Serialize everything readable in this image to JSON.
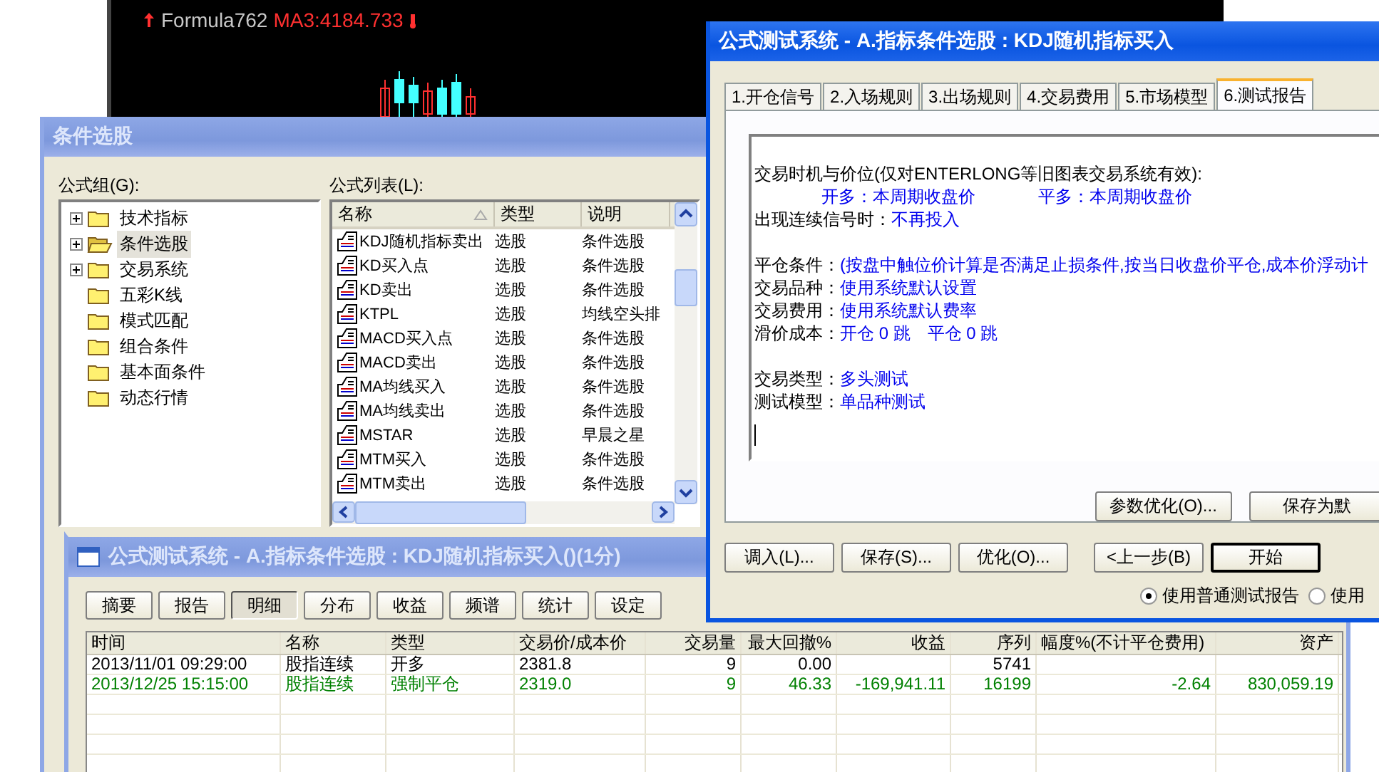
{
  "chart": {
    "indicator": "Formula762",
    "ma": "MA3:4184.733"
  },
  "stock_select": {
    "title": "条件选股",
    "group_label": "公式组(G):",
    "list_label": "公式列表(L):",
    "groups": [
      {
        "label": "技术指标",
        "expandable": true,
        "selected": false
      },
      {
        "label": "条件选股",
        "expandable": true,
        "selected": true
      },
      {
        "label": "交易系统",
        "expandable": true,
        "selected": false
      },
      {
        "label": "五彩K线",
        "expandable": false,
        "selected": false
      },
      {
        "label": "模式匹配",
        "expandable": false,
        "selected": false
      },
      {
        "label": "组合条件",
        "expandable": false,
        "selected": false
      },
      {
        "label": "基本面条件",
        "expandable": false,
        "selected": false
      },
      {
        "label": "动态行情",
        "expandable": false,
        "selected": false
      }
    ],
    "columns": [
      "名称",
      "类型",
      "说明"
    ],
    "rows": [
      {
        "name": "KDJ随机指标卖出",
        "type": "选股",
        "desc": "条件选股"
      },
      {
        "name": "KD买入点",
        "type": "选股",
        "desc": "条件选股"
      },
      {
        "name": "KD卖出",
        "type": "选股",
        "desc": "条件选股"
      },
      {
        "name": "KTPL",
        "type": "选股",
        "desc": "均线空头排"
      },
      {
        "name": "MACD买入点",
        "type": "选股",
        "desc": "条件选股"
      },
      {
        "name": "MACD卖出",
        "type": "选股",
        "desc": "条件选股"
      },
      {
        "name": "MA均线买入",
        "type": "选股",
        "desc": "条件选股"
      },
      {
        "name": "MA均线卖出",
        "type": "选股",
        "desc": "条件选股"
      },
      {
        "name": "MSTAR",
        "type": "选股",
        "desc": "早晨之星"
      },
      {
        "name": "MTM买入",
        "type": "选股",
        "desc": "条件选股"
      },
      {
        "name": "MTM卖出",
        "type": "选股",
        "desc": "条件选股"
      }
    ]
  },
  "tester": {
    "title": "公式测试系统 - A.指标条件选股 : KDJ随机指标买入",
    "tabs": [
      {
        "label": "1.开仓信号",
        "selected": false
      },
      {
        "label": "2.入场规则",
        "selected": false
      },
      {
        "label": "3.出场规则",
        "selected": false
      },
      {
        "label": "4.交易费用",
        "selected": false
      },
      {
        "label": "5.市场模型",
        "selected": false
      },
      {
        "label": "6.测试报告",
        "selected": true
      }
    ],
    "report": [
      [
        {
          "label": "交易时机与价位(仅对ENTERLONG等旧图表交易系统有效):"
        },
        {
          "values": [
            "开多：本周期收盘价",
            "平多：本周期收盘价"
          ]
        },
        {
          "label": "出现连续信号时：",
          "values": [
            "不再投入"
          ]
        }
      ],
      [
        {
          "label": "平仓条件：",
          "values": [
            "(按盘中触位价计算是否满足止损条件,按当日收盘价平仓,成本价浮动计"
          ]
        },
        {
          "label": "交易品种：",
          "values": [
            "使用系统默认设置"
          ]
        },
        {
          "label": "交易费用：",
          "values": [
            "使用系统默认费率"
          ]
        },
        {
          "label": "滑价成本：",
          "values": [
            "开仓 0 跳　平仓 0 跳"
          ]
        }
      ],
      [
        {
          "label": "交易类型：",
          "values": [
            "多头测试"
          ]
        },
        {
          "label": "测试模型：",
          "values": [
            "单品种测试"
          ]
        }
      ]
    ],
    "panel_buttons": [
      "参数优化(O)...",
      "保存为默"
    ],
    "buttons": [
      {
        "label": "调入(L)...",
        "default": false
      },
      {
        "label": "保存(S)...",
        "default": false
      },
      {
        "label": "优化(O)...",
        "default": false
      },
      {
        "label": "<上一步(B)",
        "default": false
      },
      {
        "label": "开始",
        "default": true
      }
    ],
    "report_modes": [
      {
        "label": "使用普通测试报告",
        "selected": true
      },
      {
        "label": "使用",
        "selected": false
      }
    ]
  },
  "results": {
    "title": "公式测试系统 - A.指标条件选股 : KDJ随机指标买入()(1分)",
    "views": [
      {
        "label": "摘要",
        "selected": false
      },
      {
        "label": "报告",
        "selected": false
      },
      {
        "label": "明细",
        "selected": true
      },
      {
        "label": "分布",
        "selected": false
      },
      {
        "label": "收益",
        "selected": false
      },
      {
        "label": "频谱",
        "selected": false
      },
      {
        "label": "统计",
        "selected": false
      },
      {
        "label": "设定",
        "selected": false
      }
    ],
    "columns": [
      "时间",
      "名称",
      "类型",
      "交易价/成本价",
      "交易量",
      "最大回撤%",
      "收益",
      "序列",
      "幅度%(不计平仓费用)",
      "资产"
    ],
    "rows": [
      {
        "color": "#000000",
        "cells": [
          "2013/11/01 09:29:00",
          "股指连续",
          "开多",
          "2381.8",
          "9",
          "0.00",
          null,
          "5741",
          null,
          null
        ]
      },
      {
        "color": "#008000",
        "cells": [
          "2013/12/25 15:15:00",
          "股指连续",
          "强制平仓",
          "2319.0",
          "9",
          "46.33",
          "-169,941.11",
          "16199",
          "-2.64",
          "830,059.19"
        ]
      }
    ]
  }
}
